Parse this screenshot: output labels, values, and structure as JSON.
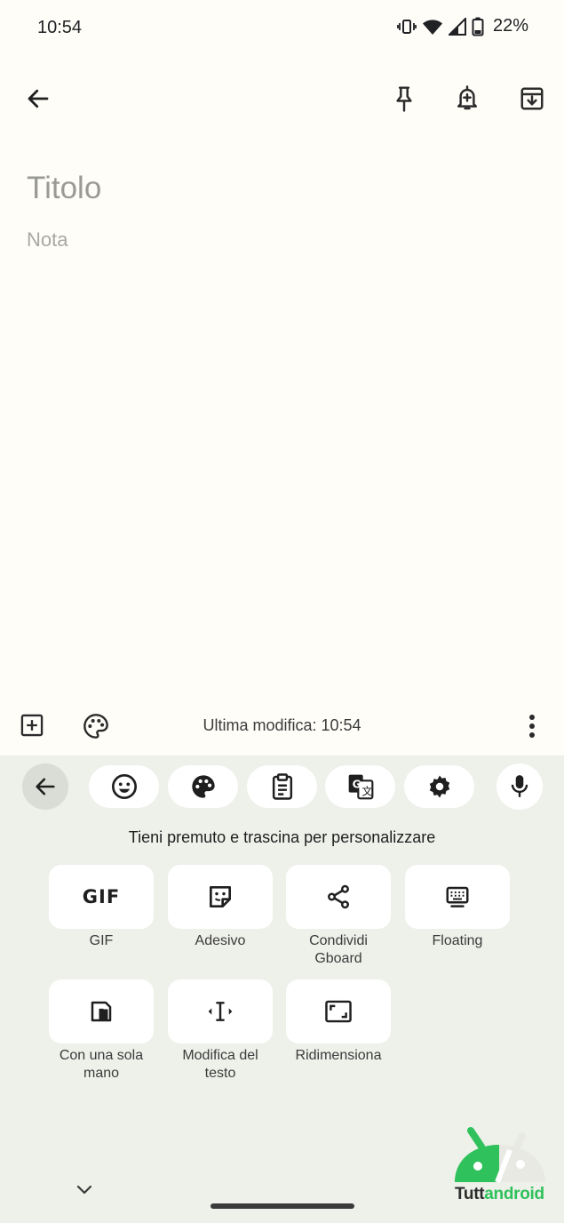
{
  "status_bar": {
    "time": "10:54",
    "battery_pct": "22%"
  },
  "toolbar": {
    "icons": [
      "back-arrow-icon",
      "pin-icon",
      "reminder-bell-icon",
      "archive-icon"
    ]
  },
  "note": {
    "title_placeholder": "Titolo",
    "body_placeholder": "Nota"
  },
  "footer": {
    "last_modified": "Ultima modifica: 10:54"
  },
  "keyboard": {
    "hint": "Tieni premuto e trascina per personalizzare",
    "tiles": [
      {
        "label": "GIF",
        "icon": "gif-icon",
        "icon_text": "GIF"
      },
      {
        "label": "Adesivo",
        "icon": "sticker-icon"
      },
      {
        "label": "Condividi\nGboard",
        "icon": "share-icon"
      },
      {
        "label": "Floating",
        "icon": "floating-keyboard-icon"
      },
      {
        "label": "Con una sola\nmano",
        "icon": "one-handed-icon"
      },
      {
        "label": "Modifica del\ntesto",
        "icon": "text-editing-icon"
      },
      {
        "label": "Ridimensiona",
        "icon": "resize-icon"
      }
    ]
  },
  "watermark": {
    "part1": "Tutt",
    "part2": "android"
  }
}
